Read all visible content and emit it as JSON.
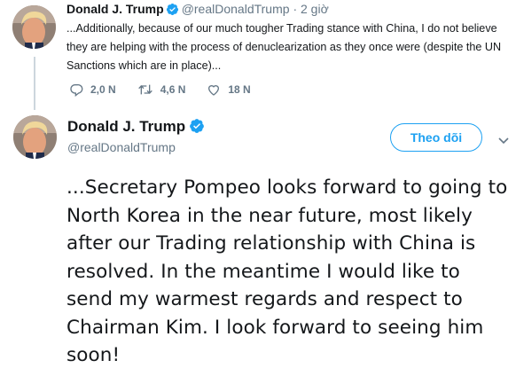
{
  "reply_tweet": {
    "name": "Donald J. Trump",
    "handle": "@realDonaldTrump",
    "separator": "·",
    "time": "2 giờ",
    "text": "...Additionally, because of our much tougher Trading stance with China, I do not believe they are helping with the process of denuclearization as they once were (despite the UN Sanctions which are in place)...",
    "actions": {
      "replies": "2,0 N",
      "retweets": "4,6 N",
      "likes": "18 N"
    }
  },
  "main_tweet": {
    "name": "Donald J. Trump",
    "handle": "@realDonaldTrump",
    "follow_label": "Theo dõi",
    "text": "...Secretary Pompeo looks forward to going to North Korea in the near future, most likely after our Trading relationship with China is resolved. In the meantime I would like to send my warmest regards and respect to Chairman Kim. I look forward to seeing him soon!"
  },
  "colors": {
    "accent": "#1da1f2",
    "muted": "#657786",
    "text": "#14171a",
    "thread_line": "#ccd6dd"
  },
  "icons": [
    "avatar",
    "verified-badge-icon",
    "reply-icon",
    "retweet-icon",
    "like-icon",
    "chevron-down-icon"
  ]
}
